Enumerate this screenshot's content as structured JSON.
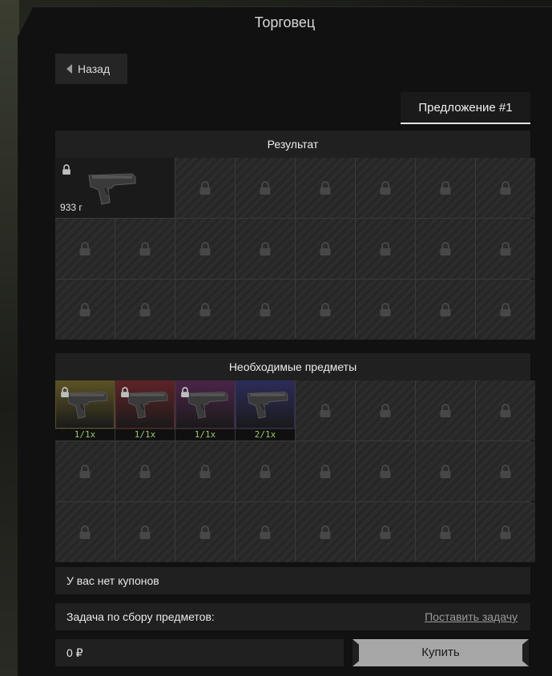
{
  "window": {
    "title": "Торговец"
  },
  "nav": {
    "back_label": "Назад"
  },
  "tabs": [
    {
      "label": "Предложение #1",
      "active": true
    }
  ],
  "result": {
    "header": "Результат",
    "item": {
      "icon": "pistol-icon",
      "weight": "933 г",
      "locked": true
    }
  },
  "required": {
    "header": "Необходимые предметы",
    "items": [
      {
        "icon": "pistol-icon",
        "count": "1/1x",
        "color": "#5b5224",
        "locked": true
      },
      {
        "icon": "pistol-icon",
        "count": "1/1x",
        "color": "#5e2326",
        "locked": true
      },
      {
        "icon": "pistol-icon",
        "count": "1/1x",
        "color": "#4a2448",
        "locked": true
      },
      {
        "icon": "pistol-icon",
        "count": "2/1x",
        "color": "#2c2c5a",
        "locked": false
      }
    ]
  },
  "coupons": {
    "text": "У вас нет купонов"
  },
  "task": {
    "label": "Задача по сбору предметов:",
    "link": "Поставить задачу"
  },
  "price": {
    "value": "0 ₽"
  },
  "buy": {
    "label": "Купить"
  },
  "colors": {
    "count_text": "#9cc66a",
    "buy_button": "#a7a7a7",
    "panel": "#202020"
  }
}
